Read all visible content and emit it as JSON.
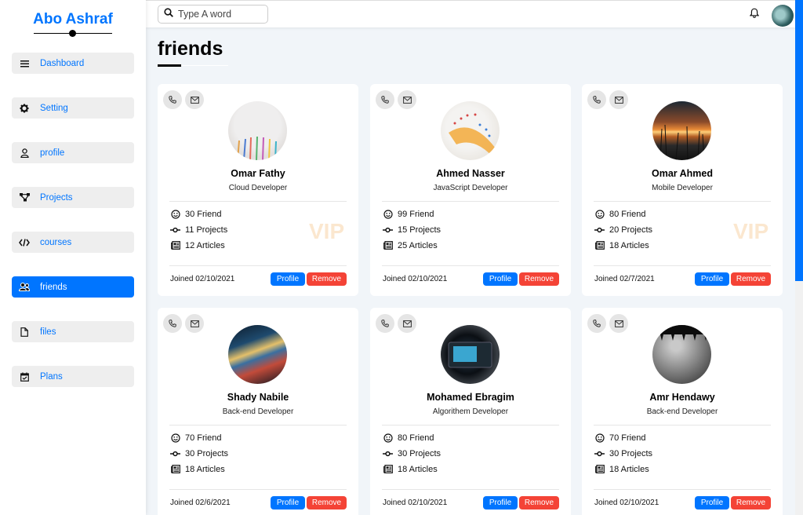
{
  "brand": "Abo Ashraf",
  "nav": [
    {
      "label": "Dashboard",
      "icon": "menu-icon",
      "active": false
    },
    {
      "label": "Setting",
      "icon": "gear-icon",
      "active": false
    },
    {
      "label": "profile",
      "icon": "user-icon",
      "active": false
    },
    {
      "label": "Projects",
      "icon": "diagram-icon",
      "active": false
    },
    {
      "label": "courses",
      "icon": "code-icon",
      "active": false
    },
    {
      "label": "friends",
      "icon": "users-icon",
      "active": true
    },
    {
      "label": "files",
      "icon": "file-icon",
      "active": false
    },
    {
      "label": "Plans",
      "icon": "calendar-check-icon",
      "active": false
    }
  ],
  "search": {
    "placeholder": "Type A word"
  },
  "page_title": "friends",
  "colors": {
    "accent": "#0075ff",
    "danger": "#f44336",
    "vip": "#fbe7cf",
    "background": "#f1f5f9"
  },
  "cards": [
    {
      "name": "Omar Fathy",
      "role": "Cloud Developer",
      "friends": "30 Friend",
      "projects": "11 Projects",
      "articles": "12 Articles",
      "vip": "VIP",
      "joined": "Joined 02/10/2021",
      "profile": "Profile",
      "remove": "Remove"
    },
    {
      "name": "Ahmed Nasser",
      "role": "JavaScript Developer",
      "friends": "99 Friend",
      "projects": "15 Projects",
      "articles": "25 Articles",
      "vip": "",
      "joined": "Joined 02/10/2021",
      "profile": "Profile",
      "remove": "Remove"
    },
    {
      "name": "Omar Ahmed",
      "role": "Mobile Developer",
      "friends": "80 Friend",
      "projects": "20 Projects",
      "articles": "18 Articles",
      "vip": "VIP",
      "joined": "Joined 02/7/2021",
      "profile": "Profile",
      "remove": "Remove"
    },
    {
      "name": "Shady Nabile",
      "role": "Back-end Developer",
      "friends": "70 Friend",
      "projects": "30 Projects",
      "articles": "18 Articles",
      "vip": "",
      "joined": "Joined 02/6/2021",
      "profile": "Profile",
      "remove": "Remove"
    },
    {
      "name": "Mohamed Ebragim",
      "role": "Algorithem Developer",
      "friends": "80 Friend",
      "projects": "30 Projects",
      "articles": "18 Articles",
      "vip": "",
      "joined": "Joined 02/10/2021",
      "profile": "Profile",
      "remove": "Remove"
    },
    {
      "name": "Amr Hendawy",
      "role": "Back-end Developer",
      "friends": "70 Friend",
      "projects": "30 Projects",
      "articles": "18 Articles",
      "vip": "",
      "joined": "Joined 02/10/2021",
      "profile": "Profile",
      "remove": "Remove"
    }
  ]
}
